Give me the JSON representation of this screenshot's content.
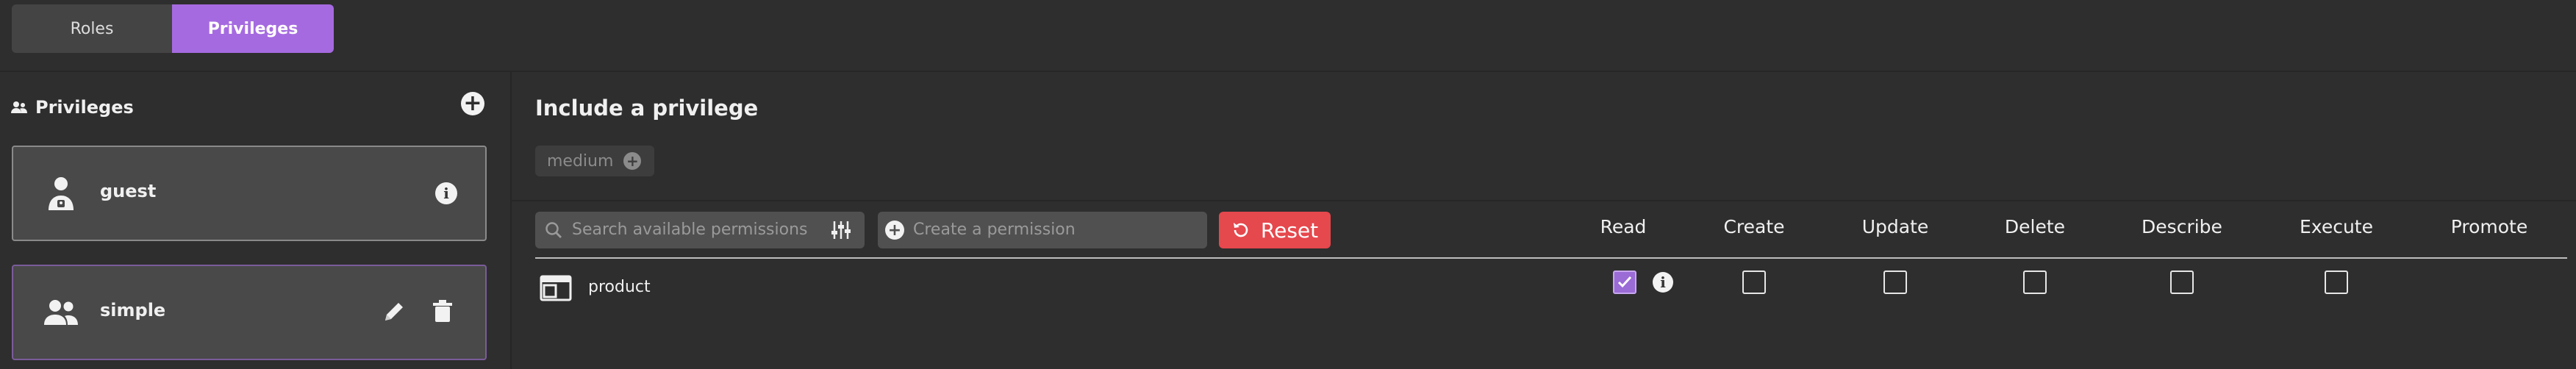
{
  "tabs": [
    {
      "label": "Roles",
      "active": false
    },
    {
      "label": "Privileges",
      "active": true
    }
  ],
  "sidebar": {
    "title": "Privileges",
    "header_icon": "users-icon",
    "add_icon": "plus-circle-icon",
    "items": [
      {
        "name": "guest",
        "icon": "user-badge-icon",
        "actions": [
          "info-icon"
        ]
      },
      {
        "name": "simple",
        "icon": "users-icon",
        "actions": [
          "edit-icon",
          "trash-icon"
        ]
      }
    ]
  },
  "main": {
    "title": "Include a privilege",
    "chips": [
      {
        "label": "medium",
        "icon": "plus-circle-icon"
      }
    ],
    "search": {
      "placeholder": "Search available permissions"
    },
    "create": {
      "placeholder": "Create a permission"
    },
    "reset_label": "Reset",
    "columns": [
      "Read",
      "Create",
      "Update",
      "Delete",
      "Describe",
      "Execute",
      "Promote"
    ],
    "rows": [
      {
        "label": "product",
        "icon": "table-layout-icon",
        "read": true,
        "create": false,
        "update": false,
        "delete": false,
        "describe": false,
        "execute": false
      }
    ]
  },
  "colors": {
    "accent": "#a56ae0",
    "danger": "#e5484d",
    "background": "#2e2e2e",
    "card": "#494949"
  }
}
